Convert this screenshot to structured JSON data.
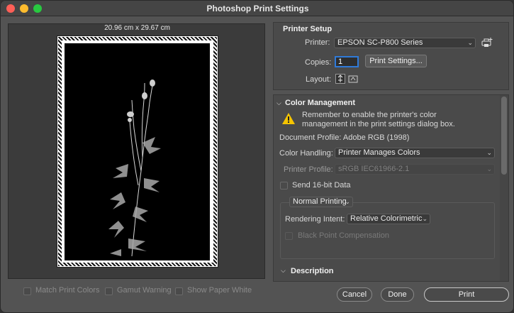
{
  "window": {
    "title": "Photoshop Print Settings"
  },
  "preview": {
    "dimensions": "20.96 cm x 29.67 cm",
    "options": [
      {
        "label": "Match Print Colors",
        "checked": false
      },
      {
        "label": "Gamut Warning",
        "checked": false
      },
      {
        "label": "Show Paper White",
        "checked": false
      }
    ]
  },
  "printer_setup": {
    "title": "Printer Setup",
    "printer_label": "Printer:",
    "printer_value": "EPSON SC-P800 Series",
    "copies_label": "Copies:",
    "copies_value": "1",
    "print_settings_button": "Print Settings...",
    "layout_label": "Layout:"
  },
  "color_management": {
    "title": "Color Management",
    "reminder": "Remember to enable the printer's color management in the print settings dialog box.",
    "document_profile": "Document Profile: Adobe RGB (1998)",
    "color_handling_label": "Color Handling:",
    "color_handling_value": "Printer Manages Colors",
    "printer_profile_label": "Printer Profile:",
    "printer_profile_value": "sRGB IEC61966-2.1",
    "send16_label": "Send 16-bit Data",
    "normal_printing": "Normal Printing",
    "rendering_intent_label": "Rendering Intent:",
    "rendering_intent_value": "Relative Colorimetric",
    "black_point_label": "Black Point Compensation"
  },
  "description": {
    "title": "Description"
  },
  "buttons": {
    "cancel": "Cancel",
    "done": "Done",
    "print": "Print"
  },
  "colors": {
    "accent": "#2f7ad8",
    "warning": "#f5c400"
  }
}
